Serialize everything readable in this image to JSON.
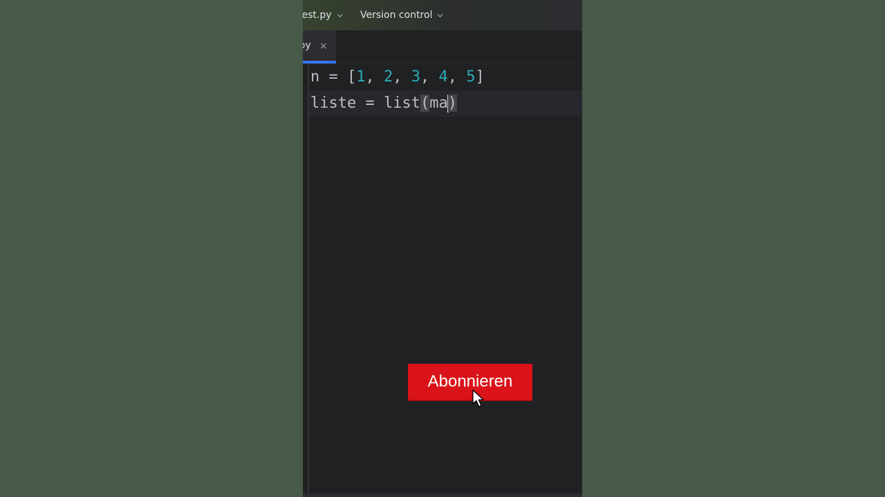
{
  "titlebar": {
    "file_label": "test.py",
    "vcs_label": "Version control"
  },
  "tab": {
    "label": ".py",
    "close_glyph": "×"
  },
  "code": {
    "line1": {
      "lhs": "n = [",
      "nums": [
        "1",
        "2",
        "3",
        "4",
        "5"
      ],
      "sep": ", ",
      "rhs": "]"
    },
    "line2": {
      "text_before": "liste = list",
      "open_paren": "(",
      "arg": "ma",
      "close_paren": ")"
    }
  },
  "overlay": {
    "subscribe_label": "Abonnieren",
    "cursor_icon": "mouse-pointer-icon"
  },
  "colors": {
    "background": "#475949",
    "editor_bg": "#1f2122",
    "number": "#2aacb8",
    "subscribe_bg": "#d91319",
    "tab_accent": "#3574f0"
  }
}
